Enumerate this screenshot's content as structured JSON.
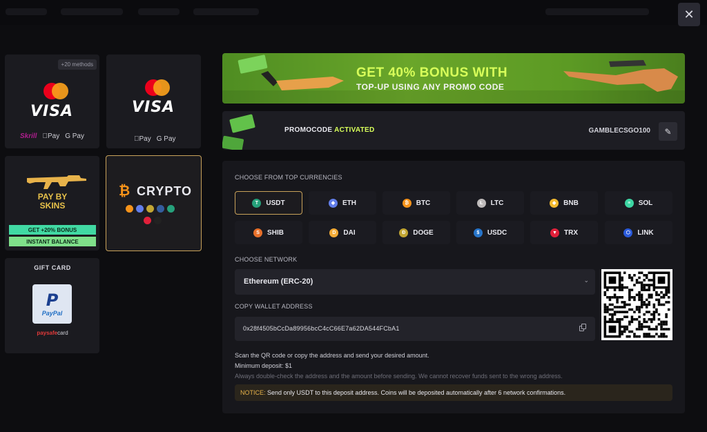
{
  "window": {
    "close_icon": "✕"
  },
  "methods": {
    "card_visa_multi": {
      "badge": "+20 methods",
      "visa": "VISA",
      "pay": [
        "Skrill",
        "Pay",
        "G Pay"
      ]
    },
    "card_visa": {
      "visa": "VISA",
      "pay": [
        "Pay",
        "G Pay"
      ]
    },
    "card_skins": {
      "title_line1": "PAY BY",
      "title_line2": "SKINS",
      "bonus": "GET +20% BONUS",
      "instant": "INSTANT BALANCE"
    },
    "card_crypto": {
      "title": "CRYPTO"
    },
    "card_gift": {
      "title": "GIFT CARD",
      "paypal_p": "P",
      "paypal": "PayPal",
      "paysafe_brand": "paysafe",
      "paysafe_suffix": "card"
    }
  },
  "banner": {
    "headline": "GET 40% BONUS WITH",
    "subline": "TOP-UP USING ANY PROMO CODE"
  },
  "promo": {
    "label": "PROMOCODE",
    "status": "ACTIVATED",
    "code": "GAMBLECSGO100",
    "edit_icon": "✎"
  },
  "deposit": {
    "currencies_label": "CHOOSE FROM TOP CURRENCIES",
    "currencies": [
      {
        "name": "USDT",
        "color": "#26a17b",
        "glyph": "T",
        "selected": true
      },
      {
        "name": "ETH",
        "color": "#627eea",
        "glyph": "◆",
        "selected": false
      },
      {
        "name": "BTC",
        "color": "#f7931a",
        "glyph": "₿",
        "selected": false
      },
      {
        "name": "LTC",
        "color": "#bfbbbb",
        "glyph": "Ł",
        "selected": false
      },
      {
        "name": "BNB",
        "color": "#f3ba2f",
        "glyph": "◆",
        "selected": false
      },
      {
        "name": "SOL",
        "color": "#3dd6a3",
        "glyph": "≡",
        "selected": false
      },
      {
        "name": "SHIB",
        "color": "#e8702a",
        "glyph": "S",
        "selected": false
      },
      {
        "name": "DAI",
        "color": "#f5ac37",
        "glyph": "D",
        "selected": false
      },
      {
        "name": "DOGE",
        "color": "#c2a633",
        "glyph": "Ð",
        "selected": false
      },
      {
        "name": "USDC",
        "color": "#2775ca",
        "glyph": "$",
        "selected": false
      },
      {
        "name": "TRX",
        "color": "#e1203a",
        "glyph": "▼",
        "selected": false
      },
      {
        "name": "LINK",
        "color": "#2a5ada",
        "glyph": "⬡",
        "selected": false
      }
    ],
    "network_label": "CHOOSE NETWORK",
    "network_value": "Ethereum (ERC-20)",
    "network_chevron": "⌄",
    "address_label": "COPY WALLET ADDRESS",
    "address": "0x28f4505bCcDa89956bcC4cC66E7a62DA544FCbA1",
    "info_line1": "Scan the QR code or copy the address and send your desired amount.",
    "info_line2": "Minimum deposit: $1",
    "info_line3": "Always double-check the address and the amount before sending. We cannot recover funds sent to the wrong address.",
    "notice_label": "NOTICE:",
    "notice_text": "Send only USDT to this deposit address. Coins will be deposited automatically after 6 network confirmations."
  }
}
